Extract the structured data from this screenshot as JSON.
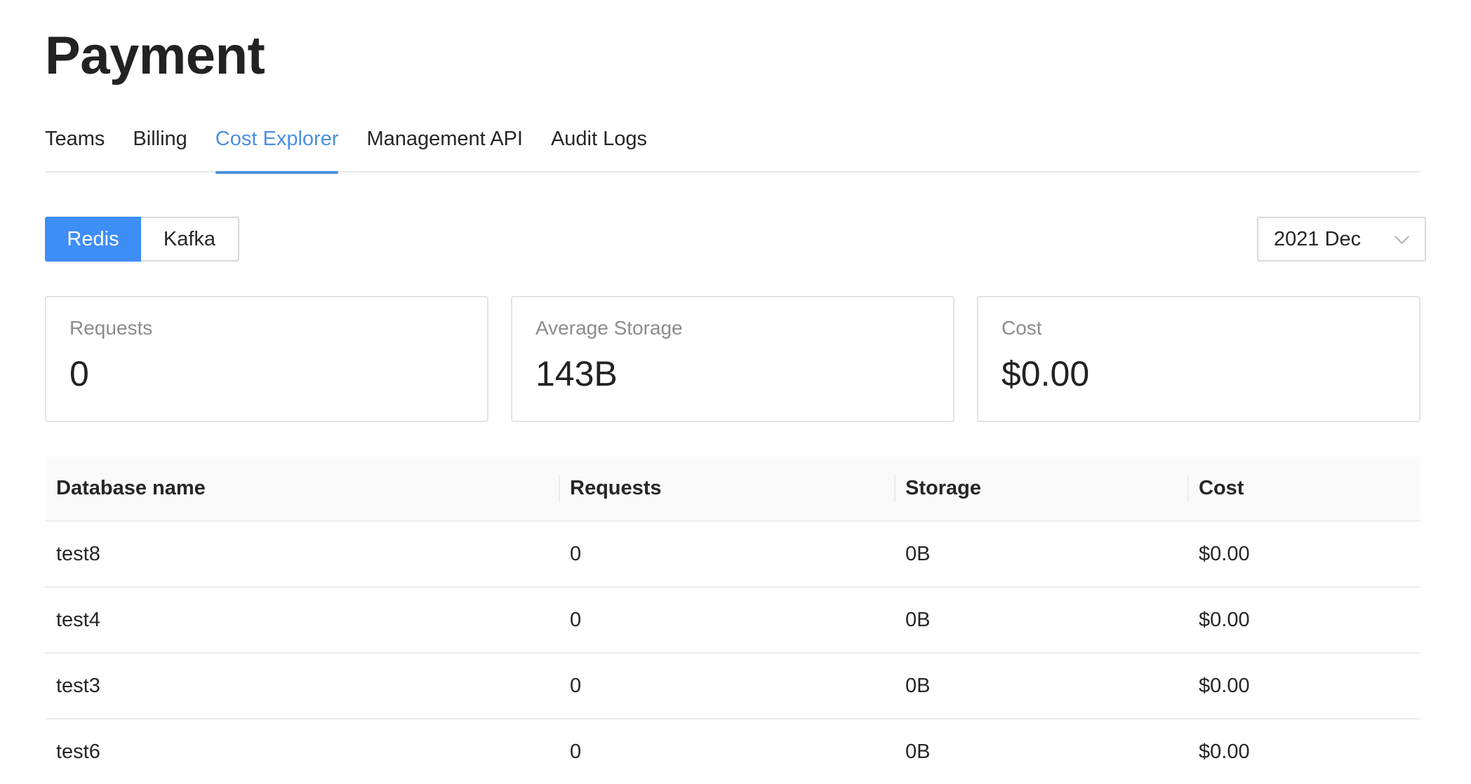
{
  "page": {
    "title": "Payment"
  },
  "tabs": [
    {
      "label": "Teams",
      "active": false
    },
    {
      "label": "Billing",
      "active": false
    },
    {
      "label": "Cost Explorer",
      "active": true
    },
    {
      "label": "Management API",
      "active": false
    },
    {
      "label": "Audit Logs",
      "active": false
    }
  ],
  "product_toggle": {
    "redis_label": "Redis",
    "kafka_label": "Kafka",
    "selected": "Redis"
  },
  "month_select": {
    "value": "2021 Dec",
    "icon": "chevron-down-icon"
  },
  "stats": {
    "requests": {
      "label": "Requests",
      "value": "0"
    },
    "average_storage": {
      "label": "Average Storage",
      "value": "143B"
    },
    "cost": {
      "label": "Cost",
      "value": "$0.00"
    }
  },
  "table": {
    "columns": [
      "Database name",
      "Requests",
      "Storage",
      "Cost"
    ],
    "rows": [
      {
        "name": "test8",
        "requests": "0",
        "storage": "0B",
        "cost": "$0.00"
      },
      {
        "name": "test4",
        "requests": "0",
        "storage": "0B",
        "cost": "$0.00"
      },
      {
        "name": "test3",
        "requests": "0",
        "storage": "0B",
        "cost": "$0.00"
      },
      {
        "name": "test6",
        "requests": "0",
        "storage": "0B",
        "cost": "$0.00"
      }
    ]
  },
  "colors": {
    "accent": "#3e8ef7",
    "active_tab": "#4a90e2",
    "border": "#e3e3e3",
    "muted_text": "#8c8c8c"
  }
}
